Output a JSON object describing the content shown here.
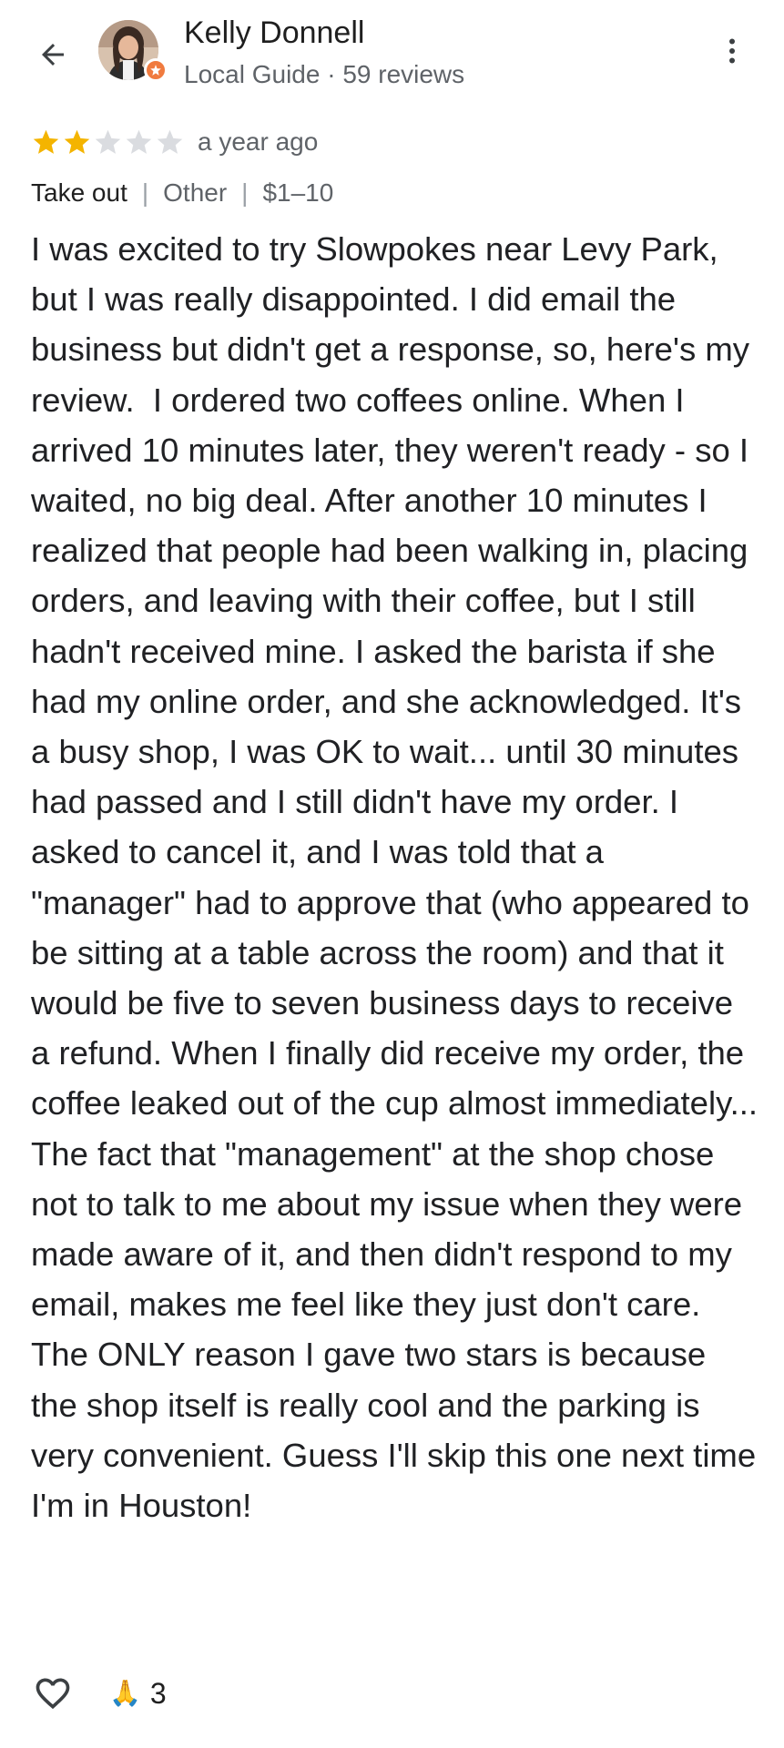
{
  "reviewer": {
    "name": "Kelly Donnell",
    "meta": "Local Guide · 59 reviews"
  },
  "review": {
    "rating": 2,
    "max_rating": 5,
    "date": "a year ago",
    "tags": [
      "Take out",
      "Other",
      "$1–10"
    ],
    "text": "I was excited to try Slowpokes near Levy Park, but I was really disappointed. I did email the business but didn't get a response, so, here's my review.  I ordered two coffees online. When I arrived 10 minutes later, they weren't ready - so I waited, no big deal. After another 10 minutes I realized that people had been walking in, placing orders, and leaving with their coffee, but I still hadn't received mine. I asked the barista if she had my online order, and she acknowledged. It's a busy shop, I was OK to wait... until 30 minutes had passed and I still didn't have my order. I asked to cancel it, and I was told that a \"manager\" had to approve that (who appeared to be sitting at a table across the room) and that it would be five to seven business days to receive a refund. When I finally did receive my order, the coffee leaked out of the cup almost immediately... The fact that \"management\" at the shop chose not to talk to me about my issue when they were made aware of it, and then didn't respond to my email, makes me feel like they just don't care. The ONLY reason I gave two stars is because the shop itself is really cool and the parking is very convenient. Guess I'll skip this one next time I'm in Houston!"
  },
  "actions": {
    "reaction_emoji": "🙏",
    "reaction_count": "3"
  },
  "icons": {
    "back": "arrow-back-icon",
    "more": "more-vert-icon",
    "local_guide_badge": "local-guide-badge-icon",
    "like": "heart-outline-icon",
    "star": "star-icon"
  },
  "colors": {
    "star_filled": "#F4B400",
    "star_empty": "#DADCE0",
    "badge": "#F07B3F",
    "secondary_text": "#5F6368"
  }
}
